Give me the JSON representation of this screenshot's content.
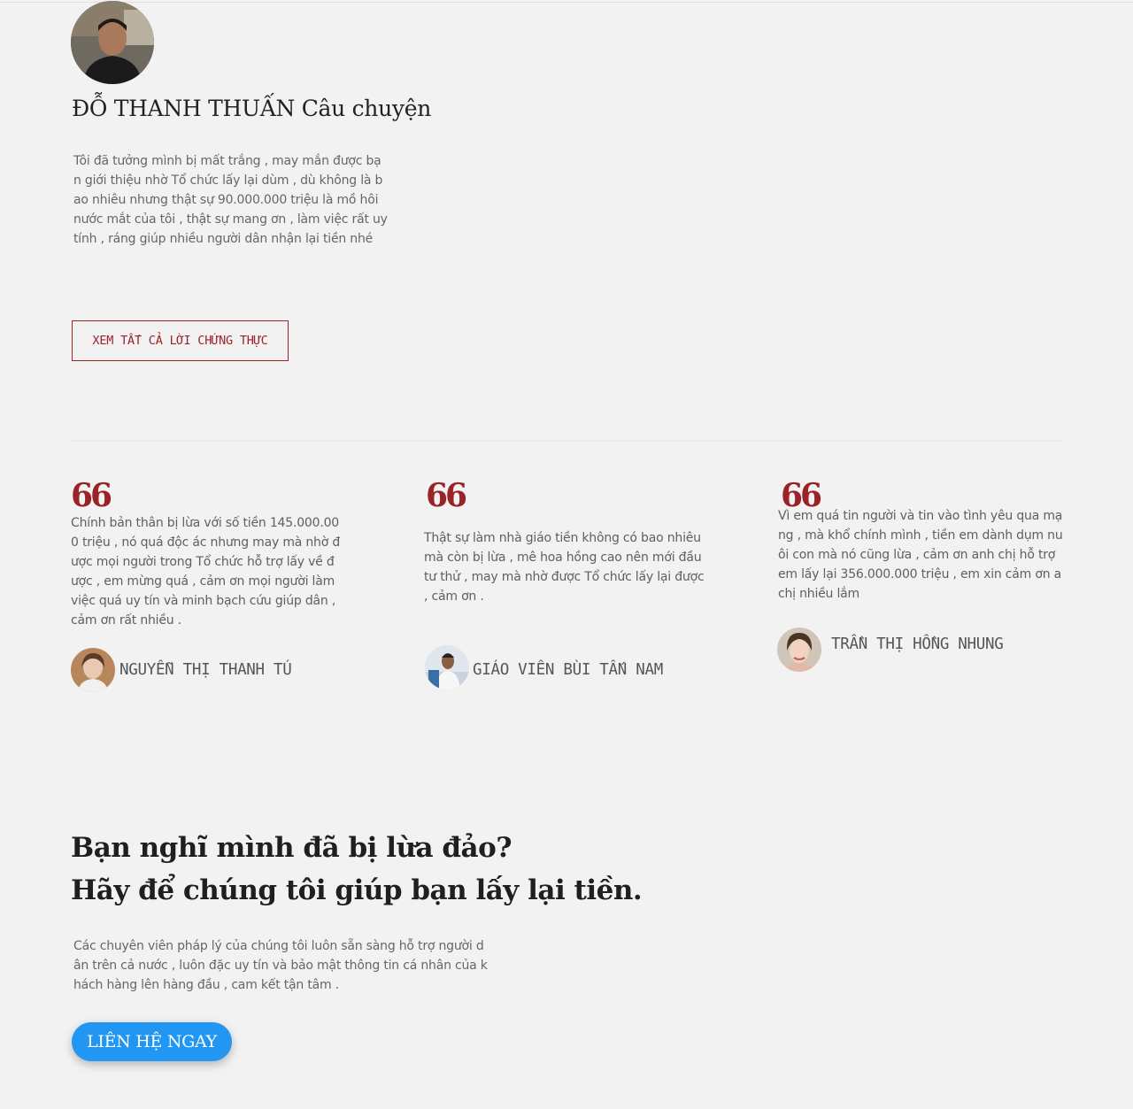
{
  "featured": {
    "title": "ĐỖ THANH THUẤN Câu chuyện",
    "text": "Tôi đã tưởng mình bị mất trắng , may mắn được bạn giới thiệu nhờ Tổ chức lấy lại dùm , dù không là bao nhiêu nhưng thật sự 90.000.000 triệu là mồ hôi nước mắt của tôi , thật sự mang ơn , làm việc rất uy tính , ráng giúp nhiều người dân nhận lại tiền nhé",
    "button_label": "XEM TẤT CẢ LỜI CHỨNG THỰC"
  },
  "testimonials": [
    {
      "quote_mark": "66",
      "text": "Chính bản thân bị lừa với số tiền 145.000.000 triệu , nó quá độc ác nhưng may mà nhờ được mọi người trong Tổ chức hỗ trợ lấy về được , em mừng quá , cảm ơn mọi người làm việc quá uy tín và minh bạch cứu giúp dân , cảm ơn rất nhiều .",
      "name": "NGUYỄN THỊ THANH TÚ"
    },
    {
      "quote_mark": "66",
      "text": "Thật sự làm nhà giáo tiền không có bao nhiêu mà còn bị lừa , mê hoa hồng cao nên mới đầu tư thử , may mà nhờ được Tổ chức lấy lại được , cảm ơn .",
      "name": "GIÁO VIÊN BÙI TẤN NAM"
    },
    {
      "quote_mark": "66",
      "text": "Vì em quá tin người và tin vào tình yêu qua mạng , mà khổ chính mình , tiền em dành dụm nuôi con mà nó cũng lừa , cảm ơn anh chị hỗ trợ em lấy lại 356.000.000 triệu , em xin cảm ơn a chị nhiều lắm",
      "name": "TRẦN THỊ HỒNG NHUNG"
    }
  ],
  "cta": {
    "headline_1": "Bạn nghĩ mình đã bị lừa đảo?",
    "headline_2": "Hãy để chúng tôi giúp bạn lấy lại tiền.",
    "text": "Các chuyên viên pháp lý của chúng tôi luôn sẵn sàng hỗ trợ người dân trên cả nước , luôn đặc uy tín và bảo mật thông tin cá nhân của khách hàng lên hàng đầu , cam kết tận tâm .",
    "button_label": "LIÊN HỆ NGAY"
  },
  "colors": {
    "accent": "#9b2226",
    "cta_button": "#2196f3",
    "background": "#f2f2f2"
  }
}
